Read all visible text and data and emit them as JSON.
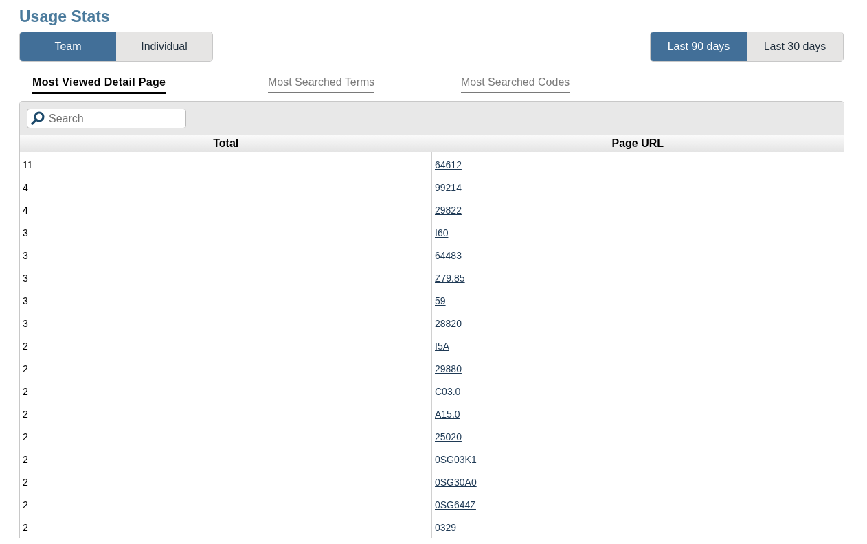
{
  "title": "Usage Stats",
  "scope_toggle": [
    {
      "label": "Team",
      "selected": true
    },
    {
      "label": "Individual",
      "selected": false
    }
  ],
  "period_toggle": [
    {
      "label": "Last 90 days",
      "selected": true
    },
    {
      "label": "Last 30 days",
      "selected": false
    }
  ],
  "tabs": [
    {
      "label": "Most Viewed Detail Page",
      "selected": true
    },
    {
      "label": "Most Searched Terms",
      "selected": false
    },
    {
      "label": "Most Searched Codes",
      "selected": false
    }
  ],
  "search": {
    "placeholder": "Search"
  },
  "table": {
    "columns": [
      "Total",
      "Page URL"
    ],
    "rows": [
      {
        "total": "11",
        "page_url": "64612"
      },
      {
        "total": "4",
        "page_url": "99214"
      },
      {
        "total": "4",
        "page_url": "29822"
      },
      {
        "total": "3",
        "page_url": "I60"
      },
      {
        "total": "3",
        "page_url": "64483"
      },
      {
        "total": "3",
        "page_url": "Z79.85"
      },
      {
        "total": "3",
        "page_url": "59"
      },
      {
        "total": "3",
        "page_url": "28820"
      },
      {
        "total": "2",
        "page_url": "I5A"
      },
      {
        "total": "2",
        "page_url": "29880"
      },
      {
        "total": "2",
        "page_url": "C03.0"
      },
      {
        "total": "2",
        "page_url": "A15.0"
      },
      {
        "total": "2",
        "page_url": "25020"
      },
      {
        "total": "2",
        "page_url": "0SG03K1"
      },
      {
        "total": "2",
        "page_url": "0SG30A0"
      },
      {
        "total": "2",
        "page_url": "0SG644Z"
      },
      {
        "total": "2",
        "page_url": "0329"
      }
    ]
  }
}
